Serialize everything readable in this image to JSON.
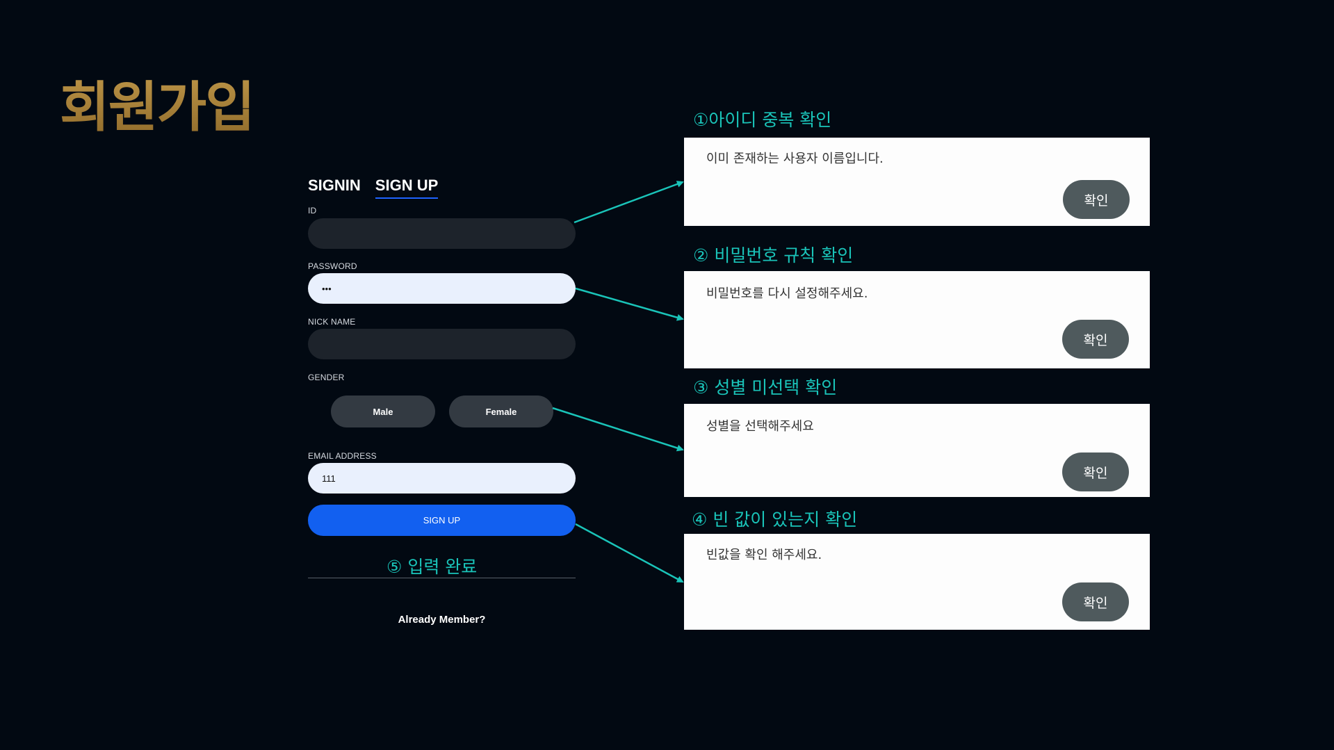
{
  "title": "회원가입",
  "form": {
    "tabs": [
      "SIGNIN",
      "SIGN UP"
    ],
    "id_label": "ID",
    "id_value": "",
    "password_label": "PASSWORD",
    "password_value": "•••",
    "nickname_label": "NICK NAME",
    "nickname_value": "",
    "gender_label": "GENDER",
    "gender_male": "Male",
    "gender_female": "Female",
    "email_label": "EMAIL ADDRESS",
    "email_value": "111",
    "submit_label": "SIGN UP",
    "already_member": "Already Member?"
  },
  "steps": [
    "①아이디 중복 확인",
    "② 비밀번호 규칙 확인",
    "③ 성별 미선택 확인",
    "④ 빈 값이 있는지 확인",
    "⑤ 입력 완료"
  ],
  "dialogs": [
    {
      "message": "이미 존재하는 사용자 이름입니다.",
      "button": "확인"
    },
    {
      "message": "비밀번호를 다시 설정해주세요.",
      "button": "확인"
    },
    {
      "message": "성별을 선택해주세요",
      "button": "확인"
    },
    {
      "message": "빈값을 확인 해주세요.",
      "button": "확인"
    }
  ],
  "colors": {
    "background": "#020912",
    "title_gold": "#a27a33",
    "annotation_teal": "#1ac4b9",
    "primary_blue": "#1260f0",
    "dialog_button": "#4f5a5d"
  }
}
